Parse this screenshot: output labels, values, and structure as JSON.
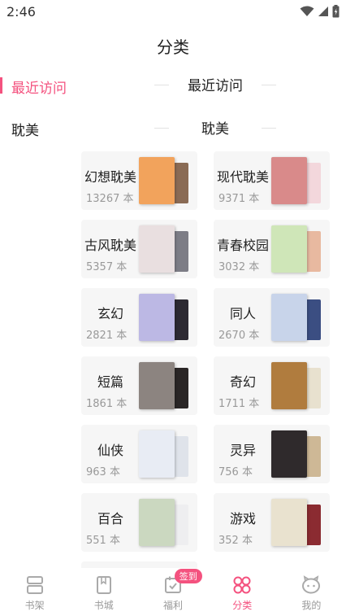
{
  "status_bar": {
    "time": "2:46"
  },
  "header": {
    "title": "分类"
  },
  "sidebar": {
    "items": [
      {
        "label": "最近访问",
        "active": true
      },
      {
        "label": "耽美",
        "active": false
      }
    ]
  },
  "sections": {
    "recent": {
      "title": "最近访问"
    },
    "danmei": {
      "title": "耽美"
    }
  },
  "categories": [
    {
      "name": "幻想耽美",
      "count": "13267 本",
      "cover": "#f2a35c",
      "back": "#8a6b55"
    },
    {
      "name": "现代耽美",
      "count": "9371 本",
      "cover": "#d98a8a",
      "back": "#f3d7dc"
    },
    {
      "name": "古风耽美",
      "count": "5357 本",
      "cover": "#e9dfe0",
      "back": "#7d7d86"
    },
    {
      "name": "青春校园",
      "count": "3032 本",
      "cover": "#cfe6b8",
      "back": "#e8b9a0"
    },
    {
      "name": "玄幻",
      "count": "2821 本",
      "cover": "#bcb8e4",
      "back": "#2d2a33"
    },
    {
      "name": "同人",
      "count": "2670 本",
      "cover": "#c8d4ea",
      "back": "#3b4e82"
    },
    {
      "name": "短篇",
      "count": "1861 本",
      "cover": "#8c8480",
      "back": "#2a2626"
    },
    {
      "name": "奇幻",
      "count": "1711 本",
      "cover": "#b07c3e",
      "back": "#e8e1cf"
    },
    {
      "name": "仙侠",
      "count": "963 本",
      "cover": "#e8ecf4",
      "back": "#dfe3ea"
    },
    {
      "name": "灵异",
      "count": "756 本",
      "cover": "#2f2a2c",
      "back": "#ceb896"
    },
    {
      "name": "百合",
      "count": "551 本",
      "cover": "#cbd8c0",
      "back": "#eeeef0"
    },
    {
      "name": "游戏",
      "count": "352 本",
      "cover": "#e9e2cf",
      "back": "#8b2b31"
    }
  ],
  "bottom_nav": {
    "items": [
      {
        "label": "书架",
        "icon": "bookshelf-icon"
      },
      {
        "label": "书城",
        "icon": "bookstore-icon"
      },
      {
        "label": "福利",
        "icon": "calendar-icon",
        "badge": "签到"
      },
      {
        "label": "分类",
        "icon": "category-grid-icon",
        "active": true
      },
      {
        "label": "我的",
        "icon": "profile-icon"
      }
    ]
  },
  "colors": {
    "accent": "#f4527f",
    "card_bg": "#f6f6f6",
    "muted_text": "#999999"
  }
}
